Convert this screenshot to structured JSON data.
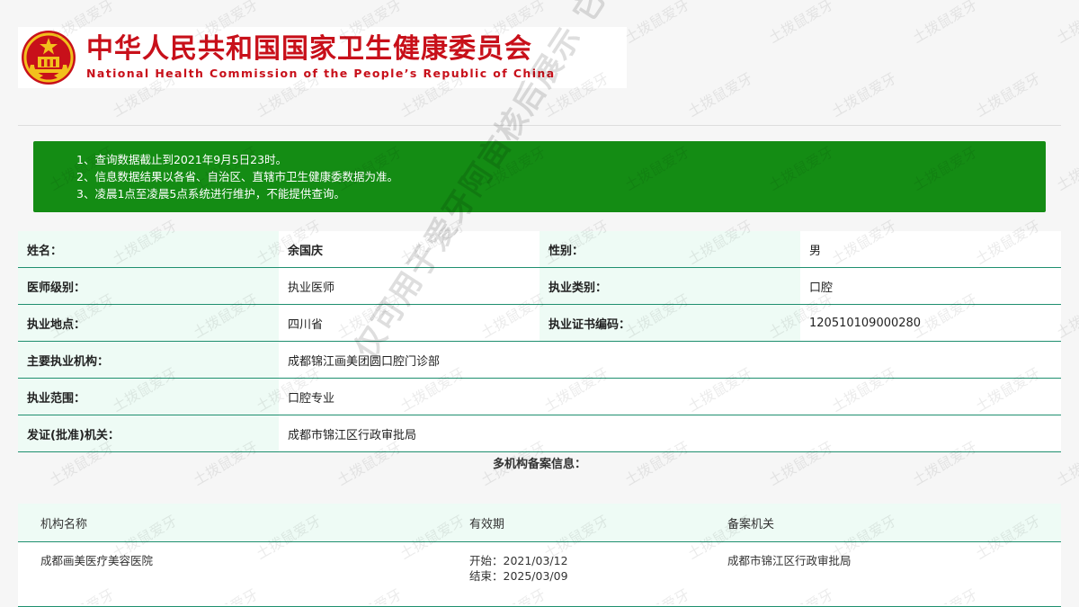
{
  "header": {
    "title_cn": "中华人民共和国国家卫生健康委员会",
    "title_en": "National Health Commission of the People’s Republic of China",
    "emblem_icon": "national-emblem-icon",
    "brand_color": "#c8101a"
  },
  "notice": {
    "bg_color": "#148c14",
    "items": [
      "1、查询数据截止到2021年9月5日23时。",
      "2、信息数据结果以各省、自治区、直辖市卫生健康委数据为准。",
      "3、凌晨1点至凌晨5点系统进行维护，不能提供查询。"
    ]
  },
  "info": {
    "name_label": "姓名：",
    "name_value": "余国庆",
    "gender_label": "性别：",
    "gender_value": "男",
    "level_label": "医师级别：",
    "level_value": "执业医师",
    "category_label": "执业类别：",
    "category_value": "口腔",
    "location_label": "执业地点：",
    "location_value": "四川省",
    "cert_label": "执业证书编码：",
    "cert_value": "120510109000280",
    "institution_label": "主要执业机构：",
    "institution_value": "成都锦江画美团圆口腔门诊部",
    "scope_label": "执业范围：",
    "scope_value": "口腔专业",
    "issuer_label": "发证(批准)机关：",
    "issuer_value": "成都市锦江区行政审批局"
  },
  "multi": {
    "title": "多机构备案信息：",
    "headers": [
      "机构名称",
      "有效期",
      "备案机关"
    ],
    "rows": [
      {
        "name": "成都画美医疗美容医院",
        "start": "开始：2021/03/12",
        "end": "结束：2025/03/09",
        "authority": "成都市锦江区行政审批局"
      }
    ]
  },
  "watermark": {
    "tile_text": "土拨鼠爱牙",
    "diagonal_text": "仅可用于爱牙阿亩核后展示 它用无效"
  }
}
